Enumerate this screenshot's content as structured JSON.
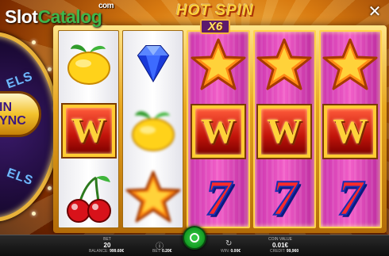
{
  "logo": {
    "part1": "Slot",
    "part2": "Catalog",
    "suffix": "com"
  },
  "title": {
    "main": "HOT SPIN",
    "sub": "X6"
  },
  "wheel": {
    "label_top": "ELS",
    "banner_line1": "IN",
    "banner_line2": "YNC",
    "label_bottom": "ELS"
  },
  "close_icon": "close-icon",
  "reels": [
    {
      "hot": false,
      "symbols": [
        "lemon",
        "w",
        "cherry"
      ]
    },
    {
      "hot": false,
      "symbols": [
        "diamond",
        "lemon",
        "star"
      ]
    },
    {
      "hot": true,
      "symbols": [
        "star",
        "w",
        "seven"
      ]
    },
    {
      "hot": true,
      "symbols": [
        "star",
        "w",
        "seven"
      ]
    },
    {
      "hot": true,
      "symbols": [
        "star",
        "w",
        "seven"
      ]
    }
  ],
  "w_letter": "W",
  "seven_glyph": "7",
  "bottom": {
    "bet_label": "BET",
    "bet_value": "20",
    "coin_label": "COIN VALUE",
    "coin_value": "0.01€",
    "balance_label": "BALANCE:",
    "balance_value": "999.60€",
    "bet_total_label": "BET:",
    "bet_total_value": "0.20€",
    "win_label": "WIN:",
    "win_value": "0.00€",
    "credit_label": "CREDIT:",
    "credit_value": "99,960"
  },
  "colors": {
    "spin_button": "#139a22",
    "reel_hot": "#e94fc0",
    "frame_gold": "#e7a51e"
  }
}
